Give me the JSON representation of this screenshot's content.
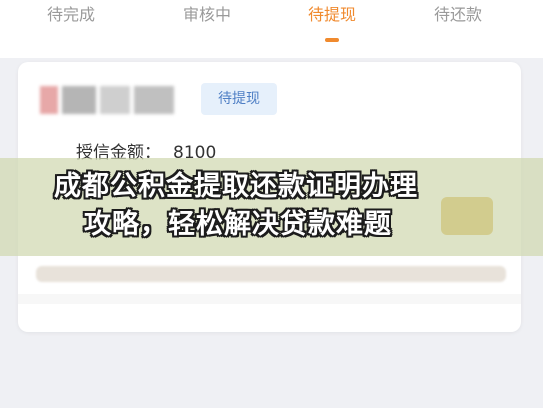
{
  "tabs": [
    {
      "label": "待完成",
      "active": false
    },
    {
      "label": "审核中",
      "active": false
    },
    {
      "label": "待提现",
      "active": true
    },
    {
      "label": "待还款",
      "active": false
    }
  ],
  "card": {
    "status_badge": "待提现",
    "credit_label": "授信金额：",
    "credit_value": "8100"
  },
  "overlay_title": {
    "line1": "成都公积金提取还款证明办理",
    "line2": "攻略，轻松解决贷款难题"
  },
  "colors": {
    "accent": "#f08a2e",
    "badge_text": "#4f7fc5",
    "badge_bg": "#e6f0fb",
    "button": "#d8ae37",
    "page_bg": "#eff0f4"
  }
}
